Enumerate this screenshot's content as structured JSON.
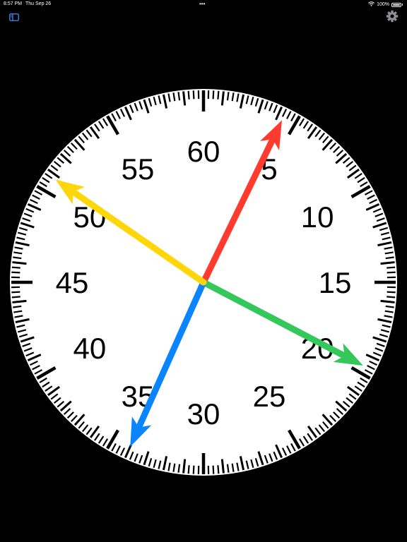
{
  "status_bar": {
    "time": "8:57 PM",
    "date": "Thu Sep 26",
    "dots": "•••",
    "battery_percent": "100%",
    "battery_level": 1.0
  },
  "toolbar": {
    "sidebar_icon": "sidebar-icon",
    "settings_icon": "gear-icon"
  },
  "dial": {
    "numbers": [
      "60",
      "5",
      "10",
      "15",
      "20",
      "25",
      "30",
      "35",
      "40",
      "45",
      "50",
      "55"
    ],
    "face_color": "#ffffff",
    "tick_color": "#000000"
  },
  "hands": [
    {
      "name": "red",
      "color": "#ff3b30",
      "seconds": 4.3
    },
    {
      "name": "green",
      "color": "#34c759",
      "seconds": 19.6
    },
    {
      "name": "blue",
      "color": "#0a84ff",
      "seconds": 34.0
    },
    {
      "name": "yellow",
      "color": "#ffd60a",
      "seconds": 50.8
    }
  ]
}
